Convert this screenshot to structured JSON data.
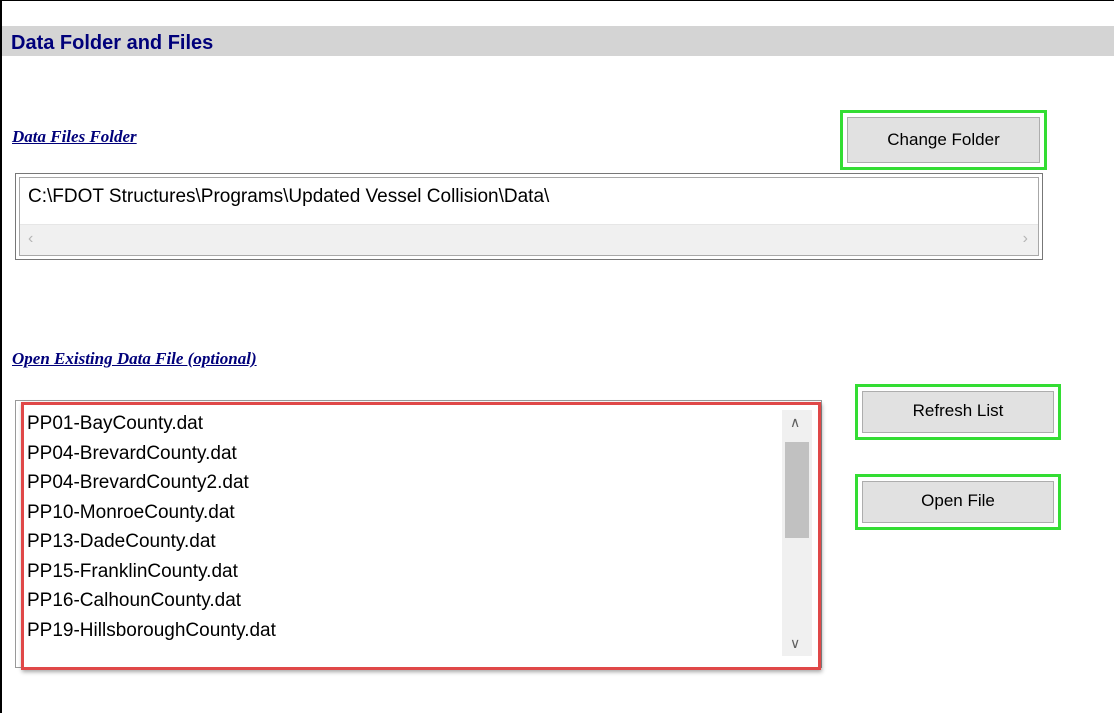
{
  "section": {
    "title": "Data Folder and Files"
  },
  "folder": {
    "label": "Data Files Folder",
    "change_button": "Change Folder",
    "path": "C:\\FDOT Structures\\Programs\\Updated Vessel Collision\\Data\\"
  },
  "files": {
    "label": "Open Existing Data File (optional)",
    "refresh_button": "Refresh List",
    "open_button": "Open File",
    "items": [
      "PP01-BayCounty.dat",
      "PP04-BrevardCounty.dat",
      "PP04-BrevardCounty2.dat",
      "PP10-MonroeCounty.dat",
      "PP13-DadeCounty.dat",
      "PP15-FranklinCounty.dat",
      "PP16-CalhounCounty.dat",
      "PP19-HillsboroughCounty.dat"
    ]
  },
  "icons": {
    "scroll_left": "chevron-left-icon",
    "scroll_right": "chevron-right-icon",
    "scroll_up": "chevron-up-icon",
    "scroll_down": "chevron-down-icon"
  },
  "colors": {
    "header_text": "#00007a",
    "header_bg": "#d4d4d4",
    "button_highlight": "#33dd33",
    "list_highlight": "#e04848"
  }
}
